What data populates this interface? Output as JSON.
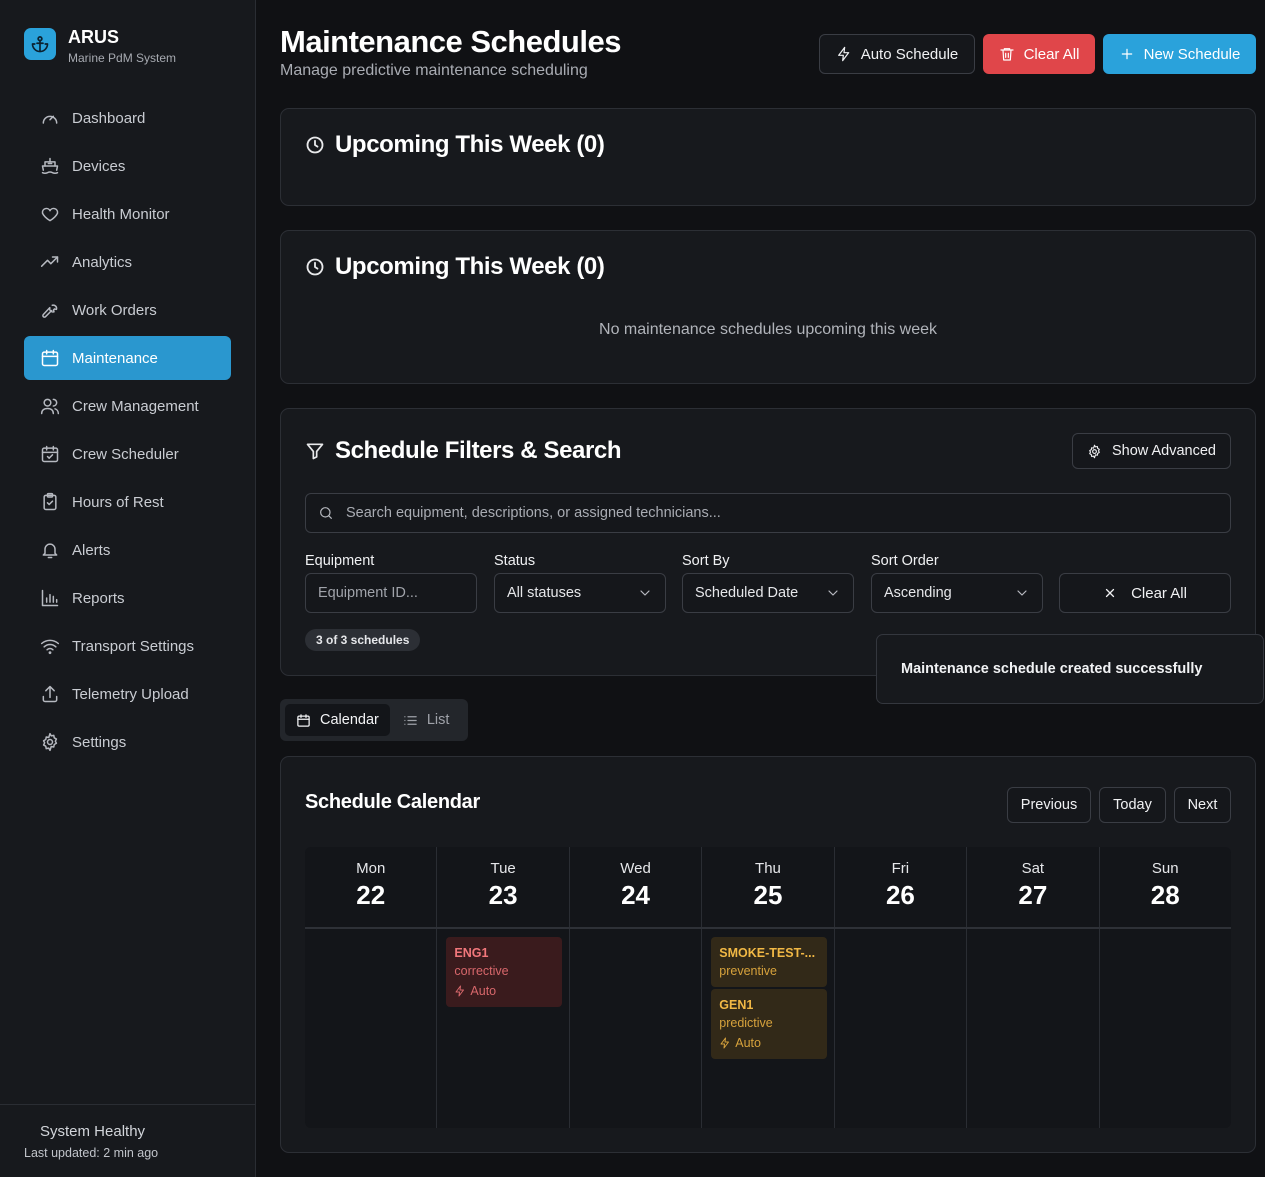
{
  "brand": {
    "name": "ARUS",
    "subtitle": "Marine PdM System",
    "logo_icon": "anchor-icon"
  },
  "nav": [
    {
      "label": "Dashboard",
      "icon": "gauge-icon",
      "active": false
    },
    {
      "label": "Devices",
      "icon": "ship-icon",
      "active": false
    },
    {
      "label": "Health Monitor",
      "icon": "heart-icon",
      "active": false
    },
    {
      "label": "Analytics",
      "icon": "trending-up-icon",
      "active": false
    },
    {
      "label": "Work Orders",
      "icon": "wrench-icon",
      "active": false
    },
    {
      "label": "Maintenance",
      "icon": "calendar-icon",
      "active": true
    },
    {
      "label": "Crew Management",
      "icon": "users-icon",
      "active": false
    },
    {
      "label": "Crew Scheduler",
      "icon": "calendar-check-icon",
      "active": false
    },
    {
      "label": "Hours of Rest",
      "icon": "clipboard-check-icon",
      "active": false
    },
    {
      "label": "Alerts",
      "icon": "bell-icon",
      "active": false
    },
    {
      "label": "Reports",
      "icon": "bar-chart-icon",
      "active": false
    },
    {
      "label": "Transport Settings",
      "icon": "wifi-icon",
      "active": false
    },
    {
      "label": "Telemetry Upload",
      "icon": "upload-icon",
      "active": false
    },
    {
      "label": "Settings",
      "icon": "gear-icon",
      "active": false
    }
  ],
  "system": {
    "status": "System Healthy",
    "updated": "Last updated: 2 min ago"
  },
  "header": {
    "title": "Maintenance Schedules",
    "subtitle": "Manage predictive maintenance scheduling",
    "auto_schedule_label": "Auto Schedule",
    "clear_all_label": "Clear All",
    "new_schedule_label": "New Schedule"
  },
  "upcoming_1": {
    "title": "Upcoming This Week (0)"
  },
  "upcoming_2": {
    "title": "Upcoming This Week (0)",
    "empty_message": "No maintenance schedules upcoming this week"
  },
  "filters": {
    "title": "Schedule Filters & Search",
    "show_advanced_label": "Show Advanced",
    "search_placeholder": "Search equipment, descriptions, or assigned technicians...",
    "equipment_label": "Equipment",
    "equipment_placeholder": "Equipment ID...",
    "status_label": "Status",
    "status_value": "All statuses",
    "sort_by_label": "Sort By",
    "sort_by_value": "Scheduled Date",
    "sort_order_label": "Sort Order",
    "sort_order_value": "Ascending",
    "clear_all_label": "Clear All",
    "count_badge": "3 of 3 schedules"
  },
  "toast": {
    "message": "Maintenance schedule created successfully"
  },
  "view_toggle": {
    "calendar_label": "Calendar",
    "list_label": "List",
    "active": "Calendar"
  },
  "calendar": {
    "title": "Schedule Calendar",
    "previous_label": "Previous",
    "today_label": "Today",
    "next_label": "Next",
    "days": [
      {
        "name": "Mon",
        "date": "22"
      },
      {
        "name": "Tue",
        "date": "23"
      },
      {
        "name": "Wed",
        "date": "24"
      },
      {
        "name": "Thu",
        "date": "25"
      },
      {
        "name": "Fri",
        "date": "26"
      },
      {
        "name": "Sat",
        "date": "27"
      },
      {
        "name": "Sun",
        "date": "28"
      }
    ],
    "events": [
      {
        "day": "Tue",
        "name": "ENG1",
        "type": "corrective",
        "auto": "Auto",
        "color": "#f1777b"
      },
      {
        "day": "Thu",
        "name": "SMOKE-TEST-...",
        "type": "preventive",
        "auto": "",
        "color": "#f1b845"
      },
      {
        "day": "Thu",
        "name": "GEN1",
        "type": "predictive",
        "auto": "Auto",
        "color": "#f1b845"
      }
    ]
  },
  "colors": {
    "accent": "#2aa2db",
    "danger": "#e0464a",
    "background": "#101114",
    "card": "#17191d"
  }
}
